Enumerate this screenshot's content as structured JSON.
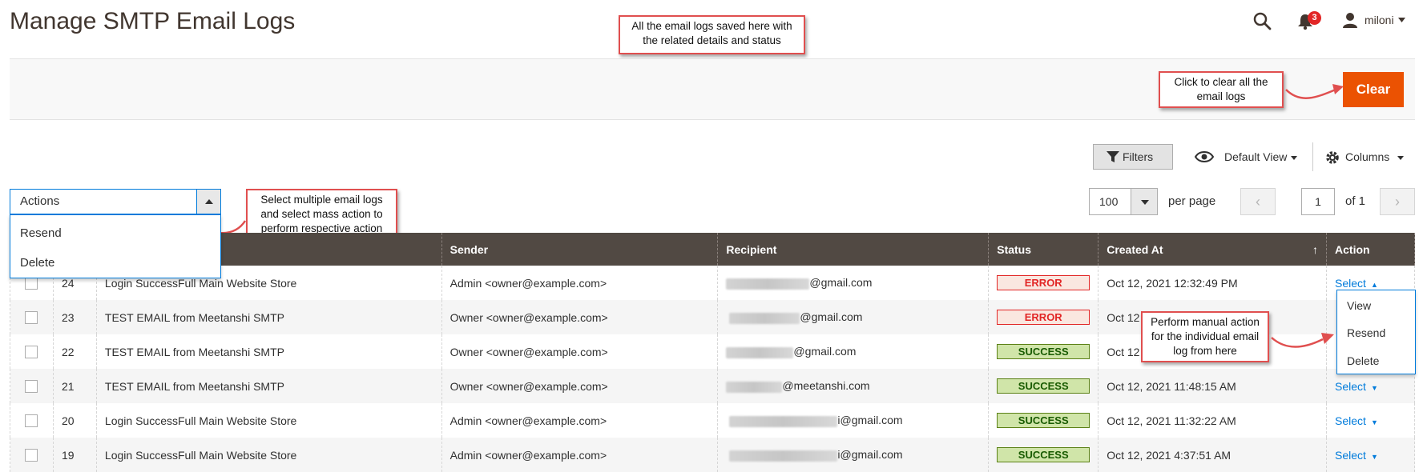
{
  "header": {
    "title": "Manage SMTP Email Logs",
    "notifications_count": "3",
    "user": "miloni",
    "icons": [
      "search-icon",
      "bell-icon",
      "user-icon"
    ]
  },
  "action_bar": {
    "clear_label": "Clear"
  },
  "callouts": {
    "top": "All the email logs saved here with the related details and status",
    "clear": "Click to clear all the email logs",
    "mass": "Select multiple email logs and select mass action to perform respective action",
    "row": "Perform manual action for the individual email log from here"
  },
  "toolbar": {
    "filters": "Filters",
    "view": "Default View",
    "columns": "Columns",
    "actions_label": "Actions",
    "mass_actions": [
      "Resend",
      "Delete"
    ],
    "per_page_value": "100",
    "per_page_label": "per page",
    "page_value": "1",
    "page_of": "of 1"
  },
  "table": {
    "columns": [
      "Sender",
      "Recipient",
      "Status",
      "Created At",
      "Action"
    ],
    "rows": [
      {
        "id": "24",
        "subject": "Login SuccessFull Main Website Store",
        "sender": "Admin <owner@example.com>",
        "recipient": "@gmail.com",
        "status": "ERROR",
        "created": "Oct 12, 2021 12:32:49 PM",
        "action": "Select"
      },
      {
        "id": "23",
        "subject": "TEST EMAIL from Meetanshi SMTP",
        "sender": "Owner <owner@example.com>",
        "recipient": "@gmail.com",
        "status": "ERROR",
        "created": "Oct 12",
        "action": ""
      },
      {
        "id": "22",
        "subject": "TEST EMAIL from Meetanshi SMTP",
        "sender": "Owner <owner@example.com>",
        "recipient": "@gmail.com",
        "status": "SUCCESS",
        "created": "Oct 12",
        "action": ""
      },
      {
        "id": "21",
        "subject": "TEST EMAIL from Meetanshi SMTP",
        "sender": "Owner <owner@example.com>",
        "recipient": "@meetanshi.com",
        "status": "SUCCESS",
        "created": "Oct 12, 2021 11:48:15 AM",
        "action": "Select"
      },
      {
        "id": "20",
        "subject": "Login SuccessFull Main Website Store",
        "sender": "Admin <owner@example.com>",
        "recipient": "i@gmail.com",
        "status": "SUCCESS",
        "created": "Oct 12, 2021 11:32:22 AM",
        "action": "Select"
      },
      {
        "id": "19",
        "subject": "Login SuccessFull Main Website Store",
        "sender": "Admin <owner@example.com>",
        "recipient": "i@gmail.com",
        "status": "SUCCESS",
        "created": "Oct 12, 2021 4:37:51 AM",
        "action": "Select"
      }
    ],
    "row_actions": [
      "View",
      "Resend",
      "Delete"
    ]
  },
  "colors": {
    "accent": "#eb5202",
    "header_bg": "#514943",
    "link": "#007bdb",
    "callout_border": "#e04f4f"
  }
}
